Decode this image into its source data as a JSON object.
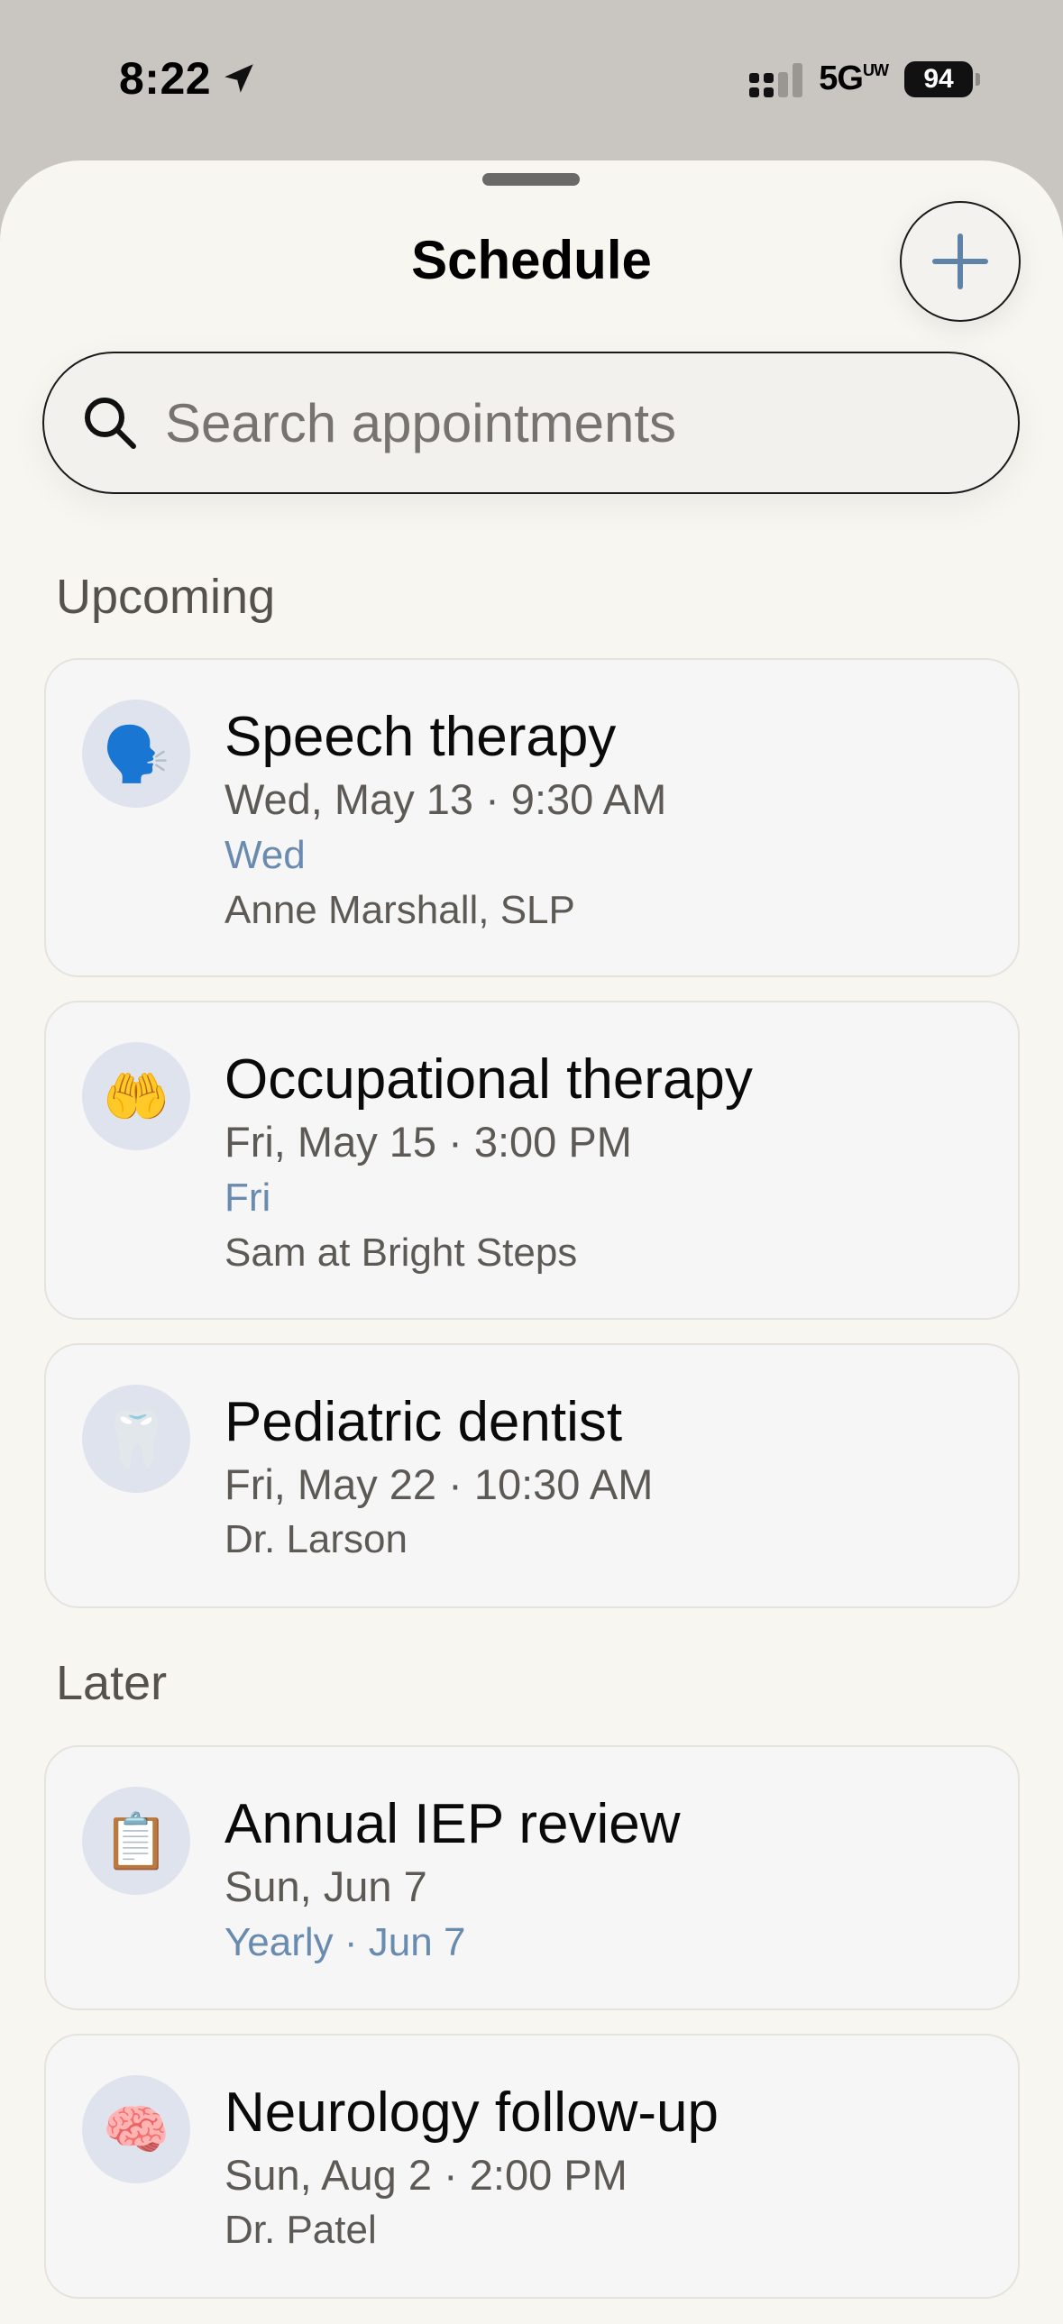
{
  "status_bar": {
    "time": "8:22",
    "network": "5G",
    "network_sup": "UW",
    "battery": "94"
  },
  "header": {
    "title": "Schedule",
    "add_icon": "plus-icon"
  },
  "search": {
    "placeholder": "Search appointments",
    "value": ""
  },
  "sections": [
    {
      "label": "Upcoming",
      "items": [
        {
          "icon": "🗣️",
          "icon_name": "speaking-head-icon",
          "title": "Speech therapy",
          "when": "Wed, May 13 · 9:30 AM",
          "recurrence": "Wed",
          "who": "Anne Marshall, SLP"
        },
        {
          "icon": "🤲",
          "icon_name": "palms-up-icon",
          "title": "Occupational therapy",
          "when": "Fri, May 15 · 3:00 PM",
          "recurrence": "Fri",
          "who": "Sam at Bright Steps"
        },
        {
          "icon": "🦷",
          "icon_name": "tooth-icon",
          "title": "Pediatric dentist",
          "when": "Fri, May 22 · 10:30 AM",
          "who": "Dr. Larson"
        }
      ]
    },
    {
      "label": "Later",
      "items": [
        {
          "icon": "📋",
          "icon_name": "clipboard-icon",
          "title": "Annual IEP review",
          "when": "Sun, Jun 7",
          "recurrence": "Yearly · Jun 7"
        },
        {
          "icon": "🧠",
          "icon_name": "brain-icon",
          "title": "Neurology follow-up",
          "when": "Sun, Aug 2 · 2:00 PM",
          "who": "Dr. Patel"
        }
      ]
    }
  ],
  "colors": {
    "accent": "#6a8bb0",
    "background": "#f8f6f1",
    "card": "#f6f6f6",
    "icon_circle": "#dfe3ee"
  }
}
